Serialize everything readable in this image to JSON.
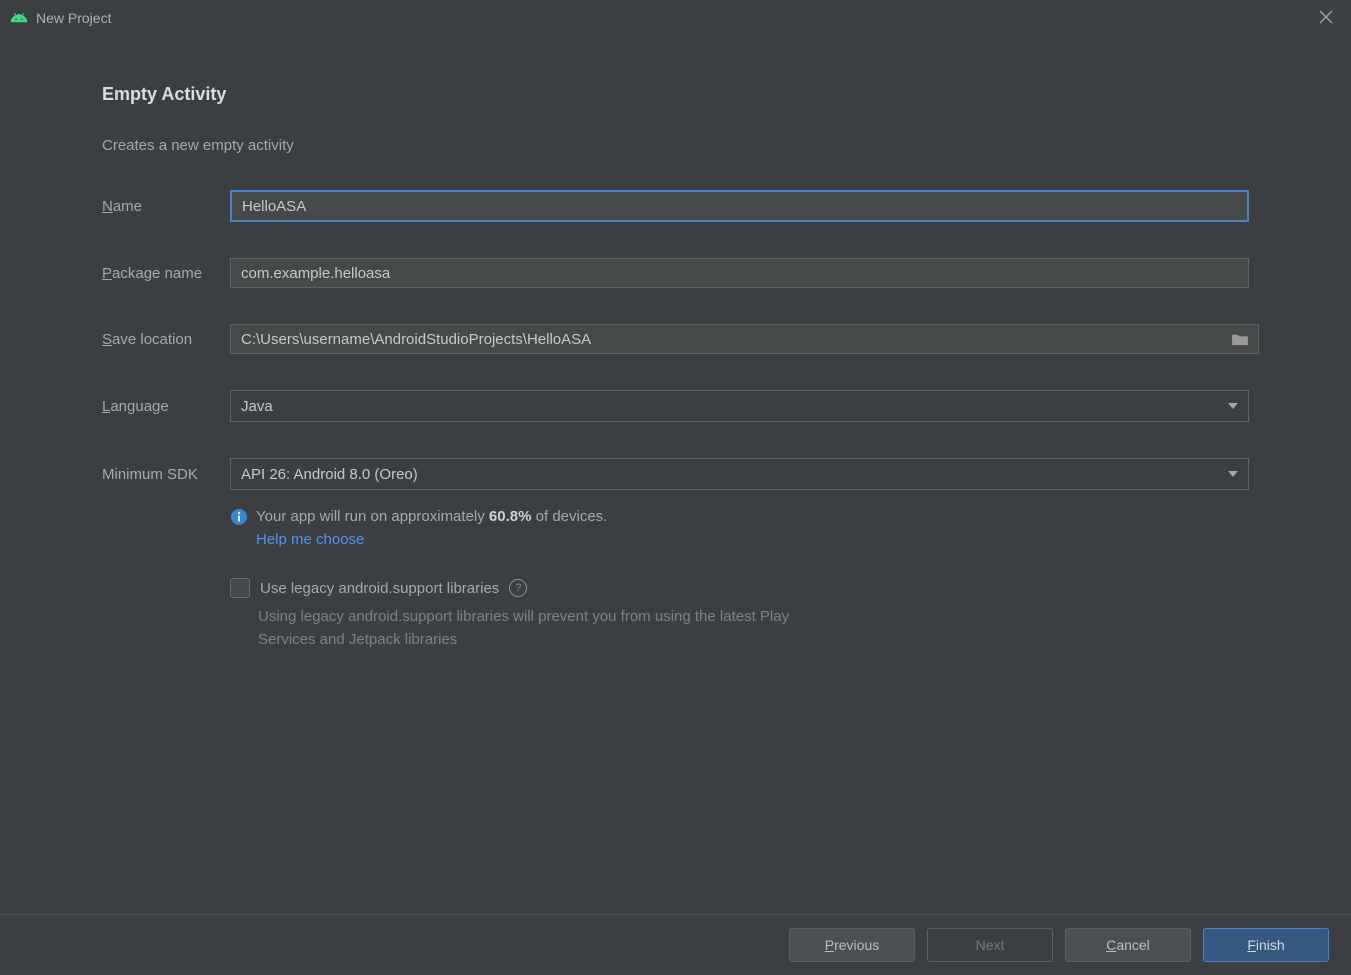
{
  "window": {
    "title": "New Project"
  },
  "header": {
    "title": "Empty Activity",
    "subtitle": "Creates a new empty activity"
  },
  "form": {
    "name_label": "Name",
    "name_value": "HelloASA",
    "package_label": "Package name",
    "package_value": "com.example.helloasa",
    "save_label": "Save location",
    "save_value": "C:\\Users\\username\\AndroidStudioProjects\\HelloASA",
    "language_label": "Language",
    "language_value": "Java",
    "minsdk_label": "Minimum SDK",
    "minsdk_value": "API 26: Android 8.0 (Oreo)"
  },
  "info": {
    "prefix": "Your app will run on approximately ",
    "percent": "60.8%",
    "suffix": " of devices.",
    "help_link": "Help me choose"
  },
  "legacy": {
    "checkbox_label": "Use legacy android.support libraries",
    "note": "Using legacy android.support libraries will prevent you from using the latest Play Services and Jetpack libraries"
  },
  "footer": {
    "previous": "Previous",
    "next": "Next",
    "cancel": "Cancel",
    "finish": "Finish"
  }
}
